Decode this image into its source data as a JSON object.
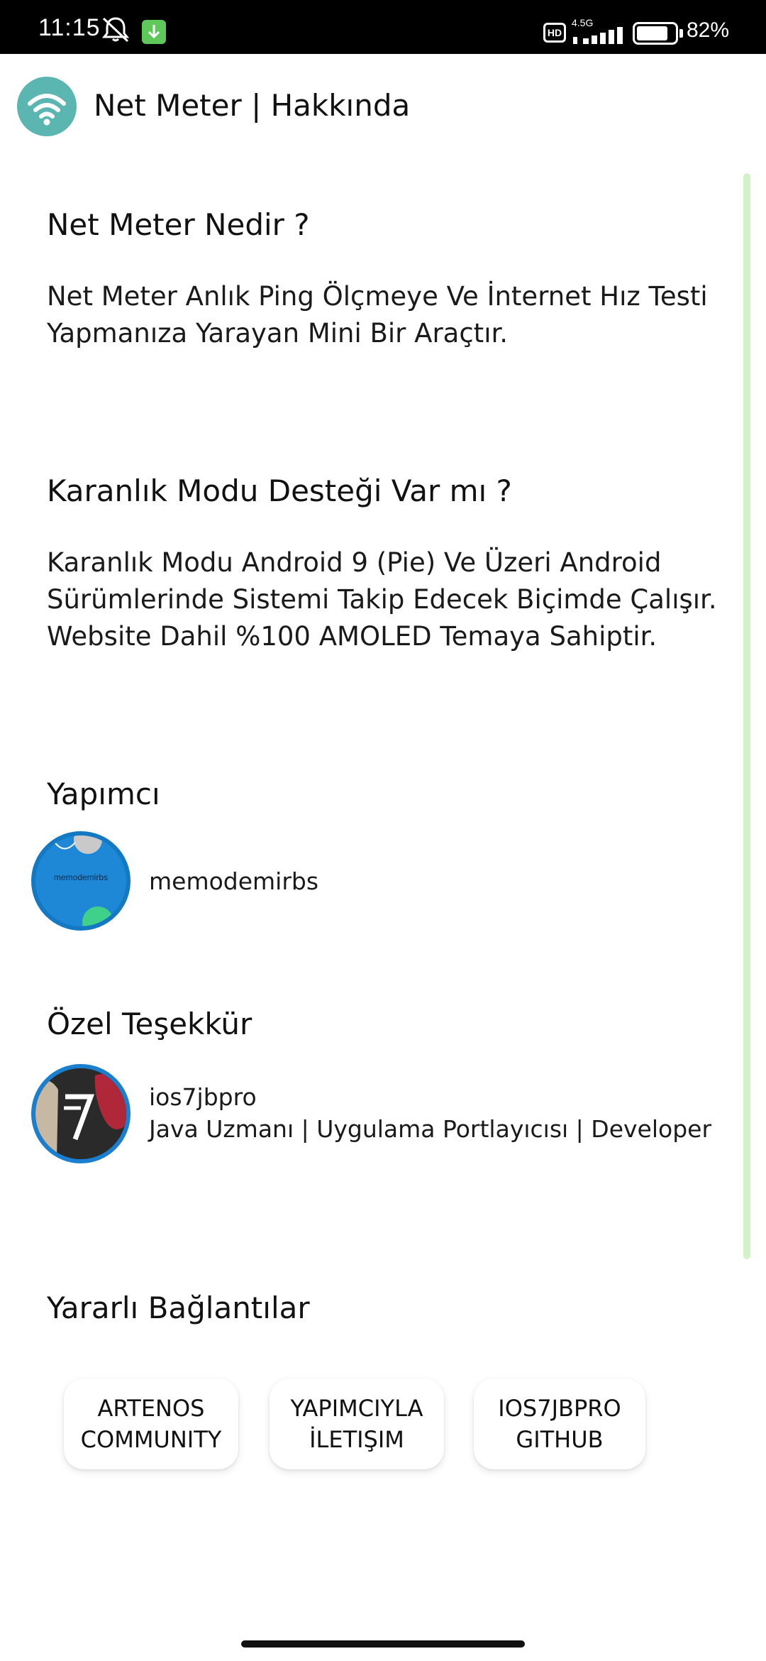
{
  "status_bar": {
    "time": "11:15",
    "network_label": "4.5G",
    "hd_label": "HD",
    "battery_percent": "82%",
    "battery_level": 0.82,
    "icons": [
      "bell-off-icon",
      "download-icon",
      "hd-icon",
      "signal-icon",
      "battery-icon"
    ],
    "download_color": "#5ec95a"
  },
  "app_bar": {
    "title": "Net Meter | Hakkında",
    "logo_icon": "wifi-icon",
    "logo_color": "#5bb6b2"
  },
  "sections": {
    "what_is": {
      "heading": "Net Meter Nedir ?",
      "body_line1": "Net Meter Anlık Ping Ölçmeye Ve İnternet Hız Testi",
      "body_line2": "Yapmanıza Yarayan Mini Bir Araçtır."
    },
    "dark_mode": {
      "heading": "Karanlık Modu Desteği Var mı ?",
      "body_line1": "Karanlık Modu Android 9 (Pie) Ve Üzeri Android",
      "body_line2": "Sürümlerinde Sistemi Takip Edecek Biçimde Çalışır.",
      "body_line3": "Website Dahil %100 AMOLED Temaya Sahiptir."
    },
    "developer": {
      "heading": "Yapımcı",
      "name": "memodemirbs",
      "avatar_text": "memodemirbs"
    },
    "thanks": {
      "heading": "Özel Teşekkür",
      "name": "ios7jbpro",
      "role": "Java Uzmanı | Uygulama Portlayıcısı | Developer"
    },
    "links": {
      "heading": "Yararlı Bağlantılar",
      "buttons": [
        {
          "label": "ARTENOS\nCOMMUNITY"
        },
        {
          "label": "YAPIMCIYLA\nİLETIŞIM"
        },
        {
          "label": "IOS7JBPRO\nGITHUB"
        }
      ]
    }
  },
  "colors": {
    "accent_scroll": "#d4f2c8",
    "avatar_blue": "#1e88d6"
  }
}
